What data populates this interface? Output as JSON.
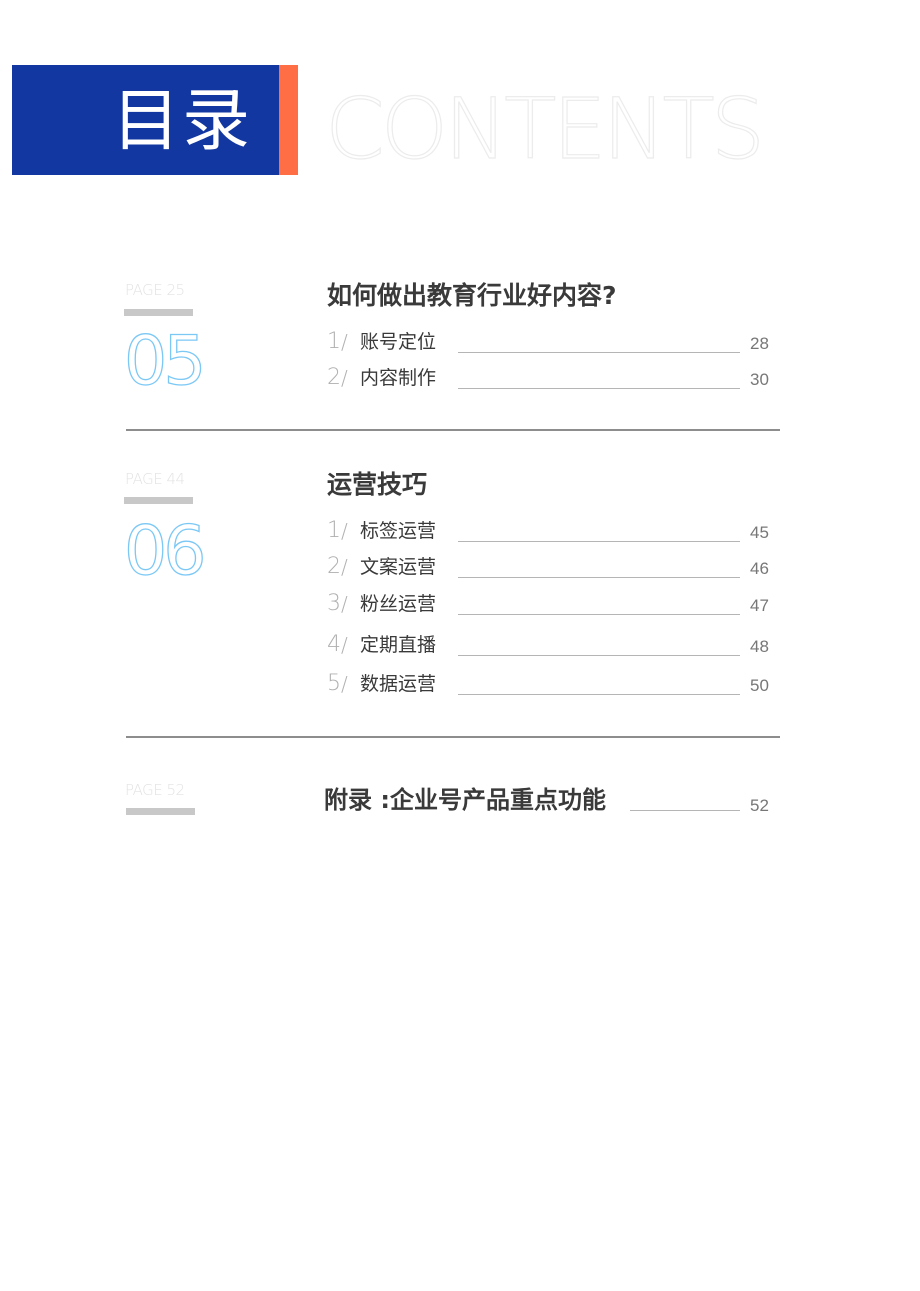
{
  "header": {
    "title": "目录",
    "subtitle": "CONTENTS",
    "colors": {
      "block": "#1237a0",
      "accent": "#ff6e45"
    }
  },
  "sections": [
    {
      "page_label": "PAGE 25",
      "number": "05",
      "title": "如何做出教育行业好内容?",
      "entries": [
        {
          "index": "1",
          "label": "账号定位",
          "page": "28"
        },
        {
          "index": "2",
          "label": "内容制作",
          "page": "30"
        }
      ]
    },
    {
      "page_label": "PAGE 44",
      "number": "06",
      "title": "运营技巧",
      "entries": [
        {
          "index": "1",
          "label": "标签运营",
          "page": "45"
        },
        {
          "index": "2",
          "label": "文案运营",
          "page": "46"
        },
        {
          "index": "3",
          "label": "粉丝运营",
          "page": "47"
        },
        {
          "index": "4",
          "label": "定期直播",
          "page": "48"
        },
        {
          "index": "5",
          "label": "数据运营",
          "page": "50"
        }
      ]
    }
  ],
  "appendix": {
    "page_label": "PAGE 52",
    "title": "附录 :企业号产品重点功能",
    "page": "52"
  },
  "separator": "/"
}
